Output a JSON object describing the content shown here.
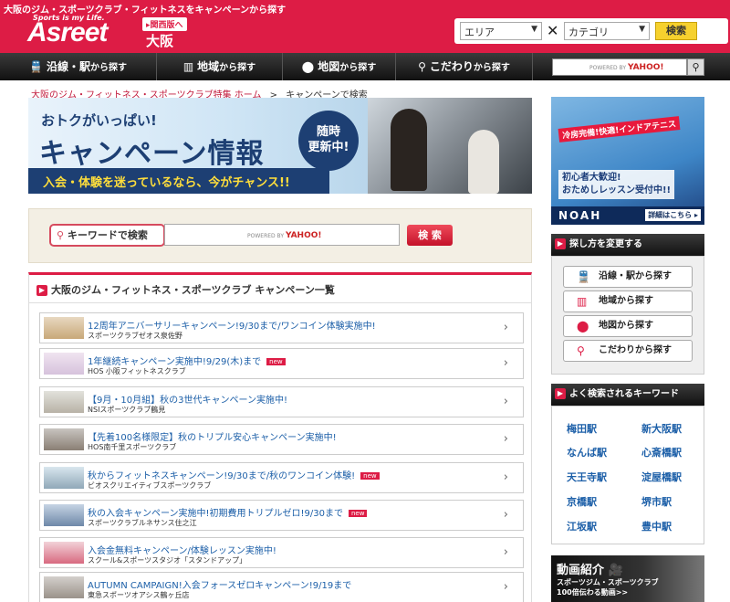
{
  "header": {
    "tagline": "大阪のジム・スポーツクラブ・フィットネスをキャンペーンから探す",
    "logo_sub": "Sports is my Life.",
    "logo": "Asreet",
    "region_badge": "関西版へ",
    "region_name": "大阪",
    "area_select": "エリア",
    "category_select": "カテゴリ",
    "search_label": "検索",
    "colors": {
      "brand": "#dd1c45",
      "search_button": "#f6d12e"
    }
  },
  "nav": {
    "items": [
      {
        "main": "沿線・駅",
        "suffix": "から探す",
        "icon": "train-icon"
      },
      {
        "main": "地域",
        "suffix": "から探す",
        "icon": "building-icon"
      },
      {
        "main": "地図",
        "suffix": "から探す",
        "icon": "map-pin-icon"
      },
      {
        "main": "こだわり",
        "suffix": "から探す",
        "icon": "search-icon"
      }
    ],
    "search_powered": "POWERED BY",
    "search_brand": "YAHOO!"
  },
  "breadcrumb": {
    "home": "大阪のジム・フィットネス・スポーツクラブ特集 ホーム",
    "separator": ">",
    "current": "キャンペーンで検索"
  },
  "banner": {
    "title_small": "おトクがいっぱい!",
    "title_large": "キャンペーン情報",
    "badge_line1": "随時",
    "badge_line2": "更新中!",
    "strip": "入会・体験を迷っているなら、今がチャンス!!"
  },
  "keyword_search": {
    "label": "キーワードで検索",
    "powered": "POWERED BY",
    "brand": "YAHOO!",
    "button": "検 索"
  },
  "campaign_list": {
    "heading": "大阪のジム・フィットネス・スポーツクラブ キャンペーン一覧",
    "new_label": "new",
    "items": [
      {
        "title": "12周年アニバーサリーキャンペーン!9/30まで/ワンコイン体験実施中!",
        "club": "スポーツクラブゼオス泉佐野",
        "new": false
      },
      {
        "title": "1年継続キャンペーン実施中!9/29(木)まで",
        "club": "HOS 小阪フィットネスクラブ",
        "new": true
      },
      {
        "title": "【9月・10月組】秋の3世代キャンペーン実施中!",
        "club": "NSIスポーツクラブ鶴見",
        "new": false
      },
      {
        "title": "【先着100名様限定】秋のトリプル安心キャンペーン実施中!",
        "club": "HOS南千里スポーツクラブ",
        "new": false
      },
      {
        "title": "秋からフィットネスキャンペーン!9/30まで/秋のワンコイン体験!",
        "club": "ビオスクリエイティブスポーツクラブ",
        "new": true
      },
      {
        "title": "秋の入会キャンペーン実施中!初期費用トリプルゼロ!9/30まで",
        "club": "スポーツクラブルネサンス住之江",
        "new": true
      },
      {
        "title": "入会金無料キャンペーン/体験レッスン実施中!",
        "club": "スクール&スポーツスタジオ「スタンドアップ」",
        "new": false
      },
      {
        "title": "AUTUMN CAMPAIGN!入会フォースゼロキャンペーン!9/19まで",
        "club": "東急スポーツオアシス鶴ヶ丘店",
        "new": false
      }
    ]
  },
  "side_banner": {
    "tag": "冷房完備!快適!インドアテニス",
    "line1": "初心者大歓迎!",
    "line2": "おためしレッスン受付中!!",
    "logo": "NOAH",
    "detail": "詳細はこちら"
  },
  "how_panel": {
    "heading": "探し方を変更する",
    "buttons": [
      {
        "label": "沿線・駅から探す",
        "icon": "train-icon"
      },
      {
        "label": "地域から探す",
        "icon": "building-icon"
      },
      {
        "label": "地図から探す",
        "icon": "map-pin-icon"
      },
      {
        "label": "こだわりから探す",
        "icon": "search-icon"
      }
    ]
  },
  "keywords_panel": {
    "heading": "よく検索されるキーワード",
    "links": [
      "梅田駅",
      "新大阪駅",
      "なんば駅",
      "心斎橋駅",
      "天王寺駅",
      "淀屋橋駅",
      "京橋駅",
      "堺市駅",
      "江坂駅",
      "豊中駅"
    ]
  },
  "video_banner": {
    "title": "動画紹介",
    "line1": "スポーツジム・スポーツクラブ",
    "line2": "100倍伝わる動画>>"
  }
}
